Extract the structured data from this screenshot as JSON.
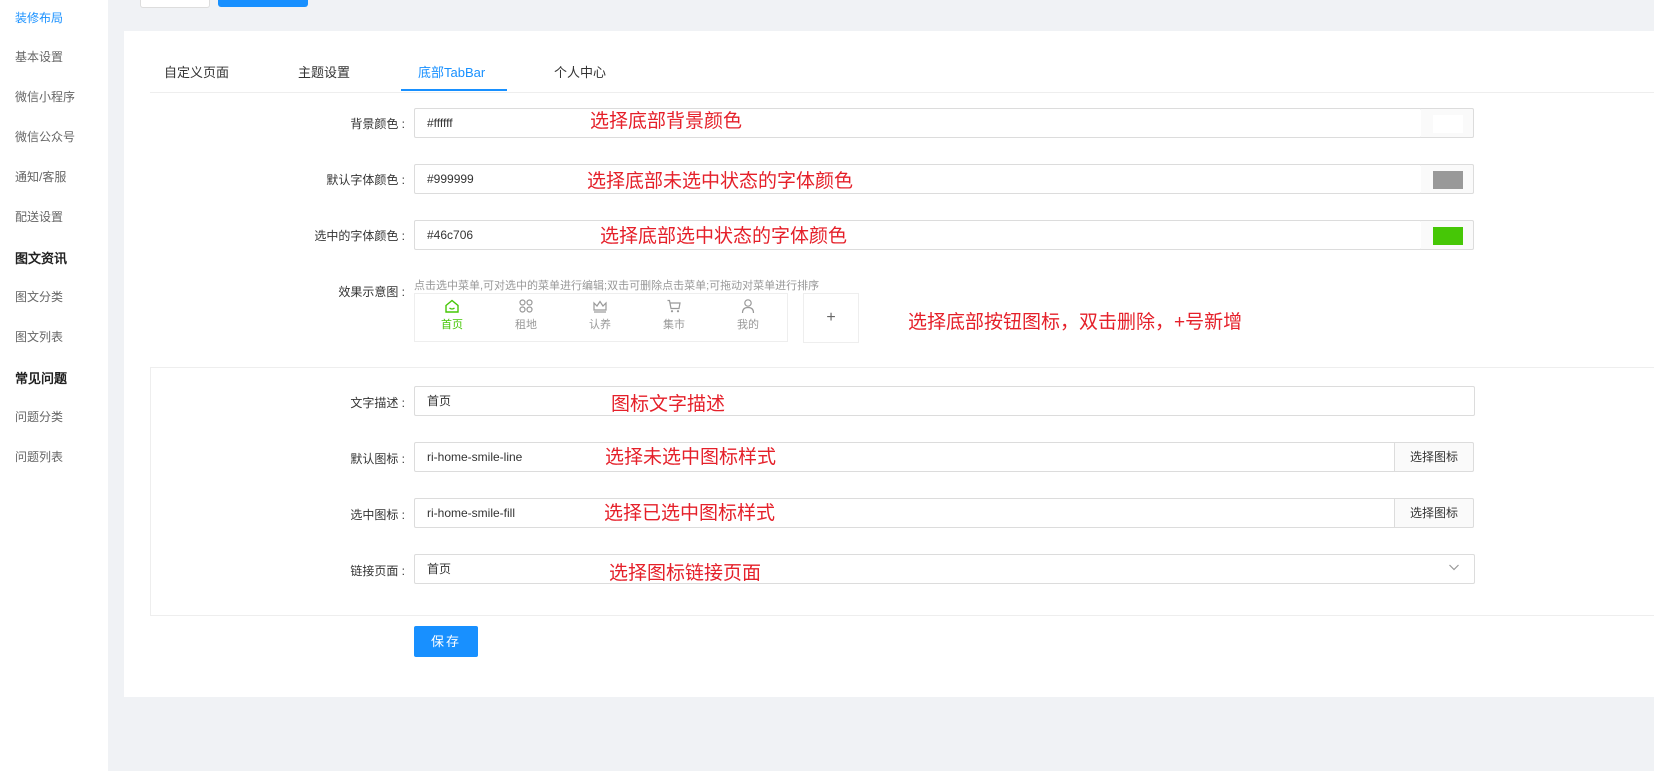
{
  "sidebar": {
    "items": [
      {
        "label": "装修布局",
        "state": "active"
      },
      {
        "label": "基本设置",
        "state": "normal"
      },
      {
        "label": "微信小程序",
        "state": "normal"
      },
      {
        "label": "微信公众号",
        "state": "normal"
      },
      {
        "label": "通知/客服",
        "state": "normal"
      },
      {
        "label": "配送设置",
        "state": "normal"
      },
      {
        "label": "图文资讯",
        "state": "group"
      },
      {
        "label": "图文分类",
        "state": "normal"
      },
      {
        "label": "图文列表",
        "state": "normal"
      },
      {
        "label": "常见问题",
        "state": "group"
      },
      {
        "label": "问题分类",
        "state": "normal"
      },
      {
        "label": "问题列表",
        "state": "normal"
      }
    ]
  },
  "tabs": [
    {
      "label": "自定义页面",
      "active": false
    },
    {
      "label": "主题设置",
      "active": false
    },
    {
      "label": "底部TabBar",
      "active": true
    },
    {
      "label": "个人中心",
      "active": false
    }
  ],
  "form": {
    "bg_color": {
      "label": "背景颜色 :",
      "value": "#ffffff",
      "swatch": "#ffffff",
      "note": "选择底部背景颜色"
    },
    "default_font_color": {
      "label": "默认字体颜色 :",
      "value": "#999999",
      "swatch": "#999999",
      "note": "选择底部未选中状态的字体颜色"
    },
    "selected_font_color": {
      "label": "选中的字体颜色 :",
      "value": "#46c706",
      "swatch": "#46c706",
      "note": "选择底部选中状态的字体颜色"
    },
    "preview": {
      "label": "效果示意图 :",
      "hint": "点击选中菜单,可对选中的菜单进行编辑;双击可删除点击菜单;可拖动对菜单进行排序",
      "items": [
        {
          "label": "首页",
          "icon": "home-icon",
          "selected": true
        },
        {
          "label": "租地",
          "icon": "apps-icon",
          "selected": false
        },
        {
          "label": "认养",
          "icon": "crown-icon",
          "selected": false
        },
        {
          "label": "集市",
          "icon": "cart-icon",
          "selected": false
        },
        {
          "label": "我的",
          "icon": "user-icon",
          "selected": false
        }
      ],
      "add_label": "+",
      "note": "选择底部按钮图标，双击删除，+号新增"
    },
    "text_desc": {
      "label": "文字描述 :",
      "value": "首页",
      "note": "图标文字描述"
    },
    "default_icon": {
      "label": "默认图标 :",
      "value": "ri-home-smile-line",
      "button": "选择图标",
      "note": "选择未选中图标样式"
    },
    "selected_icon": {
      "label": "选中图标 :",
      "value": "ri-home-smile-fill",
      "button": "选择图标",
      "note": "选择已选中图标样式"
    },
    "link_page": {
      "label": "链接页面 :",
      "value": "首页",
      "note": "选择图标链接页面"
    },
    "save_label": "保存"
  },
  "colors": {
    "accent": "#1890ff",
    "note_red": "#e5202a",
    "active_green": "#46c706"
  }
}
